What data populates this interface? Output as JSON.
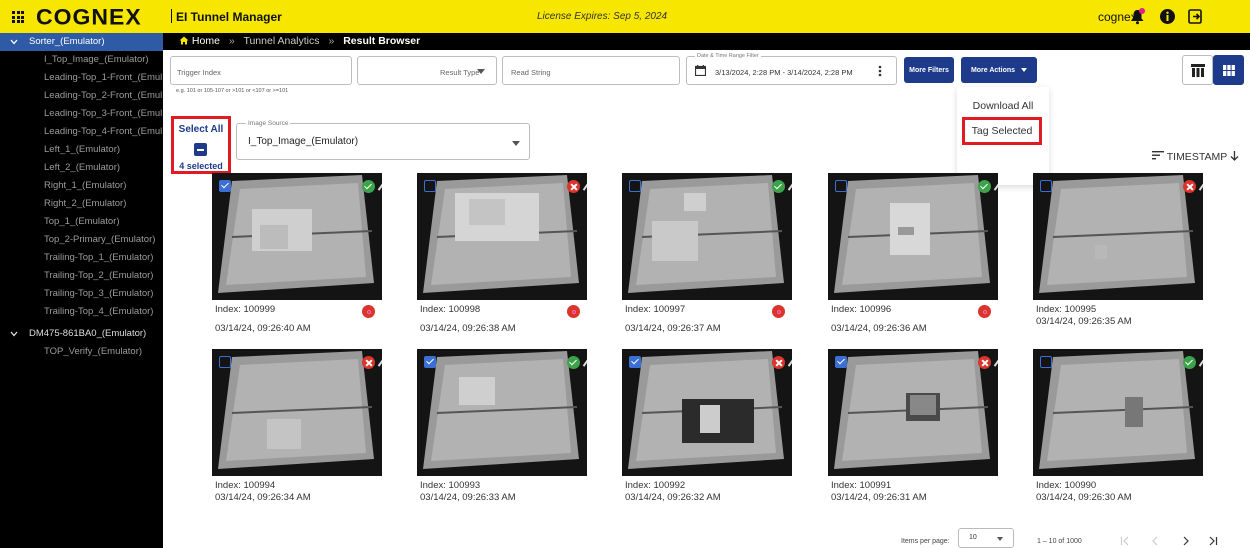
{
  "topbar": {
    "logo": "COGNEX",
    "app_name": "EI Tunnel Manager",
    "license": "License Expires: Sep 5, 2024",
    "user": "cognex",
    "colors": {
      "bar": "#f6e600",
      "accent": "#1e3a8a"
    }
  },
  "sidebar": {
    "groups": [
      {
        "label": "Sorter_(Emulator)",
        "items": [
          "I_Top_Image_(Emulator)",
          "Leading-Top_1-Front_(Emul...",
          "Leading-Top_2-Front_(Emul...",
          "Leading-Top_3-Front_(Emul...",
          "Leading-Top_4-Front_(Emul...",
          "Left_1_(Emulator)",
          "Left_2_(Emulator)",
          "Right_1_(Emulator)",
          "Right_2_(Emulator)",
          "Top_1_(Emulator)",
          "Top_2-Primary_(Emulator)",
          "Trailing-Top_1_(Emulator)",
          "Trailing-Top_2_(Emulator)",
          "Trailing-Top_3_(Emulator)",
          "Trailing-Top_4_(Emulator)"
        ]
      },
      {
        "label": "DM475-861BA0_(Emulator)",
        "items": [
          "TOP_Verify_(Emulator)"
        ]
      }
    ]
  },
  "breadcrumb": {
    "home": "Home",
    "sep": "»",
    "mid": "Tunnel Analytics",
    "current": "Result Browser"
  },
  "filters": {
    "trigger_placeholder": "Trigger Index",
    "trigger_hint": "e.g. 101 or 105-107 or >101 or <107 or >=101",
    "result_type": "Result Type",
    "read_string": "Read String",
    "date_label": "Date & Time Range Filter",
    "date_value": "3/13/2024, 2:28 PM - 3/14/2024, 2:28 PM",
    "more_filters": "More Filters",
    "more_actions": "More Actions"
  },
  "selection": {
    "select_all": "Select All",
    "count": "4 selected"
  },
  "image_source": {
    "label": "Image Source",
    "value": "I_Top_Image_(Emulator)"
  },
  "menu": {
    "items": [
      "Download All",
      "Tag Selected"
    ]
  },
  "sort": {
    "label": "TIMESTAMP"
  },
  "results": [
    {
      "index": "Index: 100999",
      "time": "03/14/24, 09:26:40 AM",
      "checked": true,
      "status": "pass",
      "error": true
    },
    {
      "index": "Index: 100998",
      "time": "03/14/24, 09:26:38 AM",
      "checked": false,
      "status": "fail",
      "error": true
    },
    {
      "index": "Index: 100997",
      "time": "03/14/24, 09:26:37 AM",
      "checked": false,
      "status": "pass",
      "error": true
    },
    {
      "index": "Index: 100996",
      "time": "03/14/24, 09:26:36 AM",
      "checked": false,
      "status": "pass",
      "error": true
    },
    {
      "index": "Index: 100995",
      "time": "03/14/24, 09:26:35 AM",
      "checked": false,
      "status": "fail",
      "error": false
    },
    {
      "index": "Index: 100994",
      "time": "03/14/24, 09:26:34 AM",
      "checked": false,
      "status": "fail",
      "error": false
    },
    {
      "index": "Index: 100993",
      "time": "03/14/24, 09:26:33 AM",
      "checked": true,
      "status": "pass",
      "error": false
    },
    {
      "index": "Index: 100992",
      "time": "03/14/24, 09:26:32 AM",
      "checked": true,
      "status": "fail",
      "error": false
    },
    {
      "index": "Index: 100991",
      "time": "03/14/24, 09:26:31 AM",
      "checked": true,
      "status": "fail",
      "error": false
    },
    {
      "index": "Index: 100990",
      "time": "03/14/24, 09:26:30 AM",
      "checked": false,
      "status": "pass",
      "error": false
    }
  ],
  "pagination": {
    "items_label": "Items per page:",
    "per_page": "10",
    "range": "1 – 10 of 1000"
  }
}
